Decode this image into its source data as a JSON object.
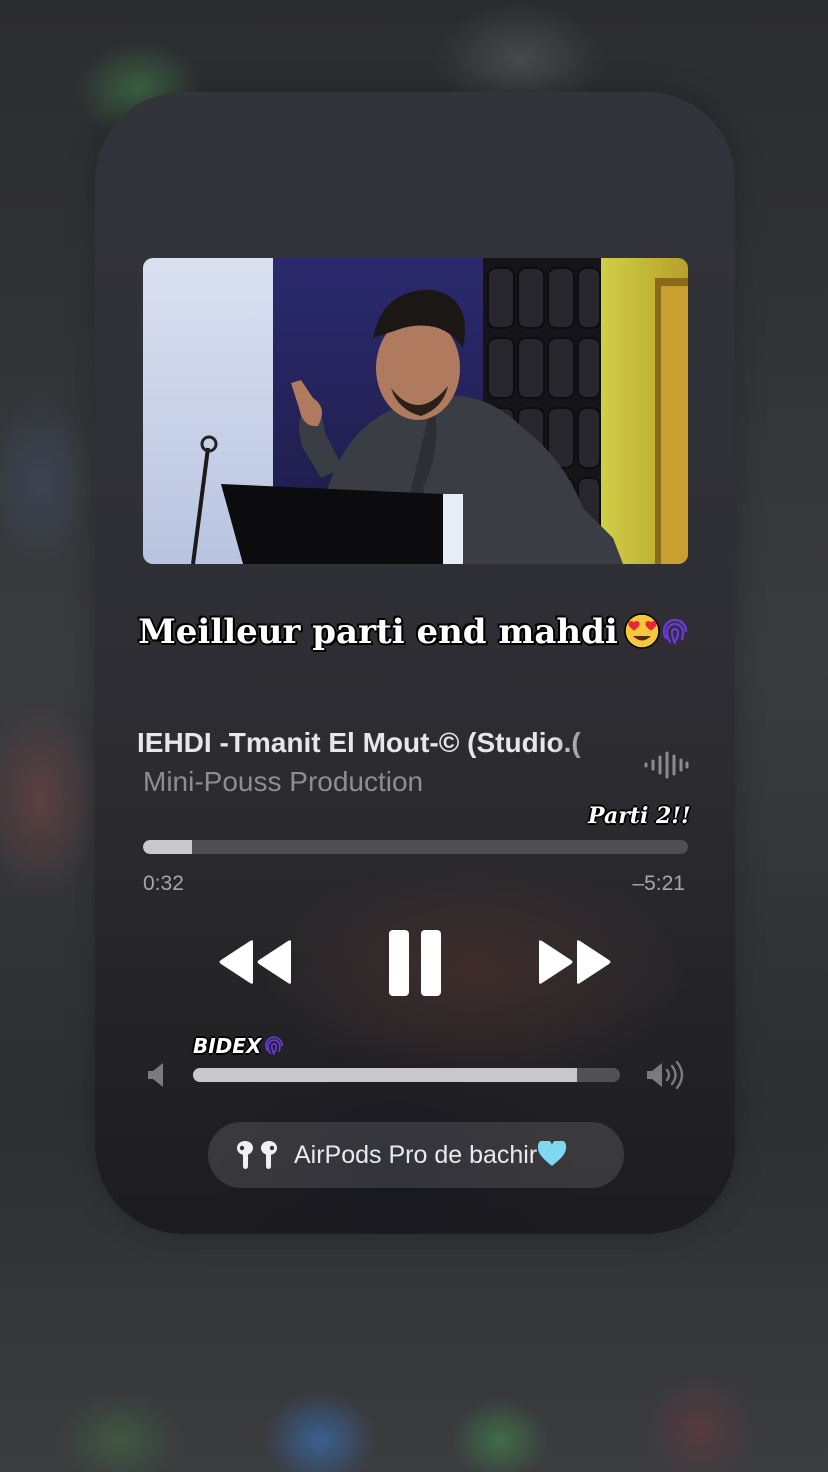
{
  "caption": {
    "text": "Meilleur parti end mahdi",
    "emojis": [
      "heart-eyes-emoji",
      "fingerprint-emoji"
    ]
  },
  "now_playing": {
    "title": "IEHDI -Tmanit El Mout-© (Studio.(",
    "artist": "Mini-Pouss Production",
    "elapsed": "0:32",
    "remaining": "–5:21",
    "progress": 0.09
  },
  "stickers": {
    "part": "Parti 2!!",
    "tag": "BIDEX"
  },
  "controls": {
    "rewind_icon": "backward-icon",
    "pause_icon": "pause-icon",
    "forward_icon": "forward-icon"
  },
  "volume": {
    "level": 0.9,
    "low_icon": "speaker-low-icon",
    "high_icon": "speaker-high-icon"
  },
  "output": {
    "device": "AirPods Pro de bachir",
    "icon": "airpods-icon",
    "emoji": "light-blue-heart-emoji"
  },
  "colors": {
    "accent_purple": "#6a38d8",
    "heart_blue": "#7fd8f0"
  }
}
